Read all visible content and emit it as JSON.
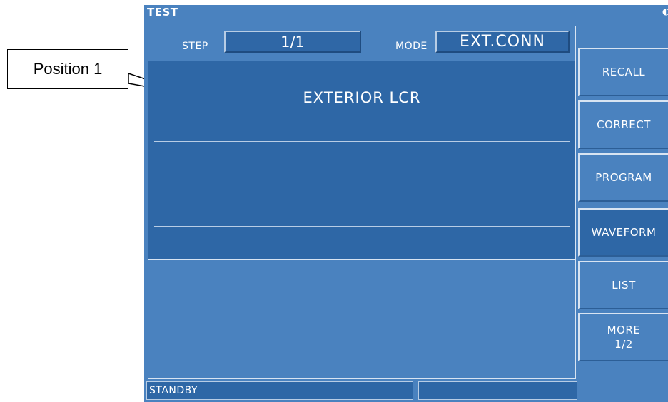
{
  "callout": {
    "label": "Position 1"
  },
  "window": {
    "title": "TEST"
  },
  "header": {
    "step_label": "STEP",
    "step_value": "1/1",
    "mode_label": "MODE",
    "mode_value": "EXT.CONN"
  },
  "content": {
    "title": "EXTERIOR LCR"
  },
  "status": {
    "state": "STANDBY",
    "secondary": ""
  },
  "softkeys": [
    {
      "line1": "RECALL",
      "line2": ""
    },
    {
      "line1": "CORRECT",
      "line2": ""
    },
    {
      "line1": "PROGRAM",
      "line2": ""
    },
    {
      "line1": "WAVEFORM",
      "line2": ""
    },
    {
      "line1": "LIST",
      "line2": ""
    },
    {
      "line1": "MORE",
      "line2": "1/2"
    }
  ],
  "colors": {
    "screen_bg": "#4a82bf",
    "field_bg": "#2f67a6",
    "border_light": "#d8e4f2",
    "text": "#ffffff"
  }
}
